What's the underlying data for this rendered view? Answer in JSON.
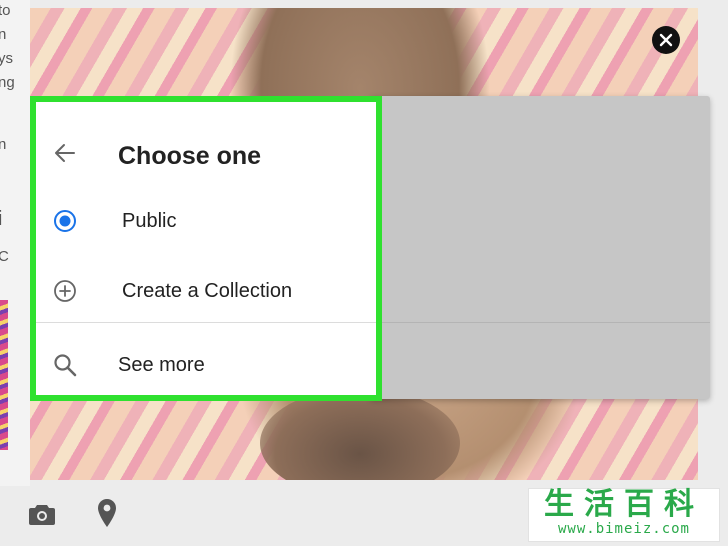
{
  "dialog": {
    "title": "Choose one",
    "items": [
      {
        "label": "Public",
        "icon": "radio-selected-icon",
        "selected": true
      },
      {
        "label": "Create a Collection",
        "icon": "add-circle-icon",
        "selected": false
      }
    ],
    "see_more": {
      "label": "See more",
      "icon": "search-icon"
    }
  },
  "left_edge": {
    "fragments": [
      "to",
      "n",
      "ys",
      "ng",
      "n",
      "i",
      "C"
    ]
  },
  "watermark": {
    "main": "生活百科",
    "url": "www.bimeiz.com"
  },
  "colors": {
    "highlight": "#2fe12f",
    "radio_accent": "#1a73e8",
    "close_bg": "#111111"
  }
}
